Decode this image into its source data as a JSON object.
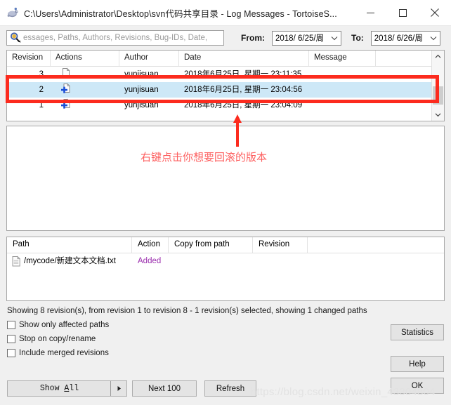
{
  "window": {
    "title": "C:\\Users\\Administrator\\Desktop\\svn代码共享目录 - Log Messages - TortoiseS...",
    "app_icon": "tortoise-svn-icon",
    "minimize_label": "–",
    "maximize_label": "☐",
    "close_label": "✕"
  },
  "filter": {
    "search_placeholder": "essages, Paths, Authors, Revisions, Bug-IDs, Date,",
    "search_value": "",
    "search_icon": "search-icon",
    "from_label": "From:",
    "from_value": "2018/ 6/25/周",
    "to_label": "To:",
    "to_value": "2018/ 6/26/周"
  },
  "log_table": {
    "columns": [
      "Revision",
      "Actions",
      "Author",
      "Date",
      "Message"
    ],
    "rows": [
      {
        "revision": "3",
        "action_icon": "modified-file-icon",
        "author": "yunjisuan",
        "date": "2018年6月25日, 星期一 23:11:35",
        "message": "",
        "selected": false
      },
      {
        "revision": "2",
        "action_icon": "added-file-icon",
        "author": "yunjisuan",
        "date": "2018年6月25日, 星期一 23:04:56",
        "message": "",
        "selected": true
      },
      {
        "revision": "1",
        "action_icon": "added-file-icon",
        "author": "yunjisuan",
        "date": "2018年6月25日, 星期一 23:04:09",
        "message": "",
        "selected": false
      }
    ]
  },
  "message_pane": {
    "text": ""
  },
  "path_table": {
    "columns": [
      "Path",
      "Action",
      "Copy from path",
      "Revision"
    ],
    "rows": [
      {
        "path": "/mycode/新建文本文档.txt",
        "path_icon": "text-file-icon",
        "action": "Added",
        "copy_from_path": "",
        "revision": ""
      }
    ]
  },
  "status": {
    "text": "Showing 8 revision(s), from revision 1 to revision 8 - 1 revision(s) selected, showing 1 changed paths"
  },
  "checkboxes": [
    {
      "label": "Show only affected paths",
      "checked": false
    },
    {
      "label": "Stop on copy/rename",
      "checked": false
    },
    {
      "label": "Include merged revisions",
      "checked": false
    }
  ],
  "buttons": {
    "show_all": "Show All",
    "show_all_dropdown_icon": "caret-right-icon",
    "next_100": "Next 100",
    "refresh": "Refresh",
    "statistics": "Statistics",
    "help": "Help",
    "ok": "OK"
  },
  "annotations": {
    "highlight_color": "#fc2b1e",
    "text_color": "#fd6060",
    "note": "右键点击你想要回滚的版本"
  },
  "watermark": {
    "text": "https://blog.csdn.net/weixin_43304804"
  }
}
